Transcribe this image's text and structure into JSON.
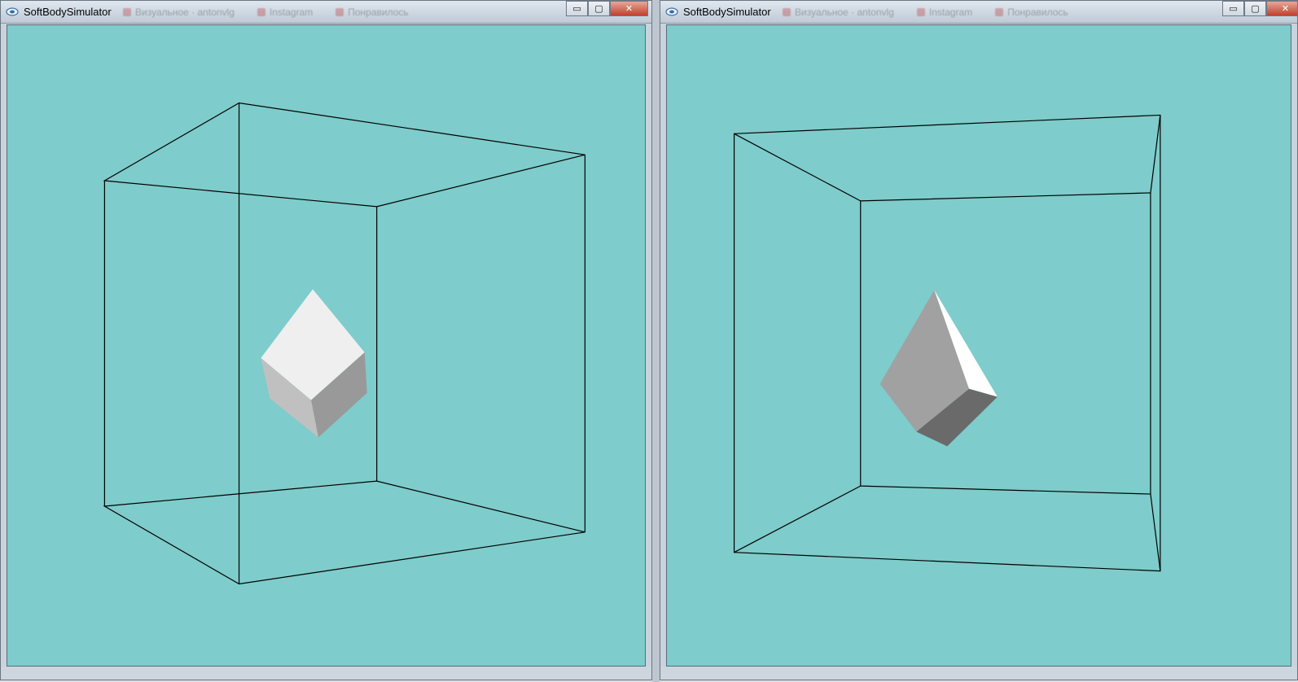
{
  "windows": [
    {
      "title": "SoftBodySimulator",
      "background_tabs": [
        "Визуальное · antonvlg",
        "Instagram",
        "Понравилось"
      ],
      "controls": {
        "minimize": "▭",
        "maximize": "▢",
        "close": "✕"
      }
    },
    {
      "title": "SoftBodySimulator",
      "background_tabs": [
        "Визуальное · antonvlg",
        "Instagram",
        "Понравилось"
      ],
      "controls": {
        "minimize": "▭",
        "maximize": "▢",
        "close": "✕"
      }
    }
  ],
  "colors": {
    "viewport_bg": "#7ecccb",
    "wireframe": "#000000",
    "face_light": "#efefef",
    "face_mid": "#c0c0c0",
    "face_dark": "#999999",
    "face_darkest": "#6a6a6a",
    "face_white": "#ffffff"
  }
}
